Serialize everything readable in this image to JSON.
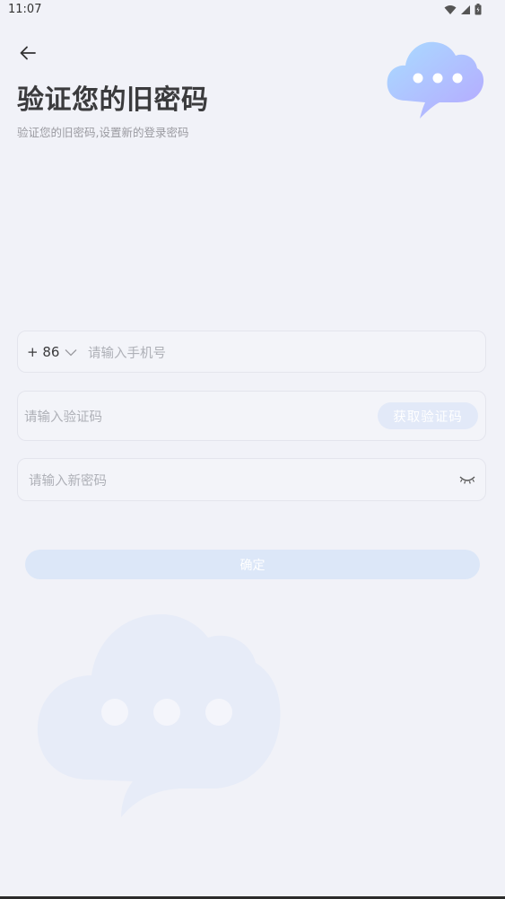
{
  "status_bar": {
    "time": "11:07",
    "icons": [
      "wifi-icon",
      "signal-icon",
      "battery-icon"
    ]
  },
  "header": {
    "back_icon": "arrow-left-icon",
    "title": "验证您的旧密码",
    "subtitle": "验证您的旧密码,设置新的登录密码"
  },
  "form": {
    "country_code": "+ 86",
    "phone_placeholder": "请输入手机号",
    "code_placeholder": "请输入验证码",
    "get_code_label": "获取验证码",
    "password_placeholder": "请输入新密码",
    "eye_icon": "eye-closed-icon"
  },
  "confirm_label": "确定",
  "colors": {
    "background": "#f1f2f8",
    "button_disabled": "#dce7f8",
    "title": "#3b3b3d"
  }
}
